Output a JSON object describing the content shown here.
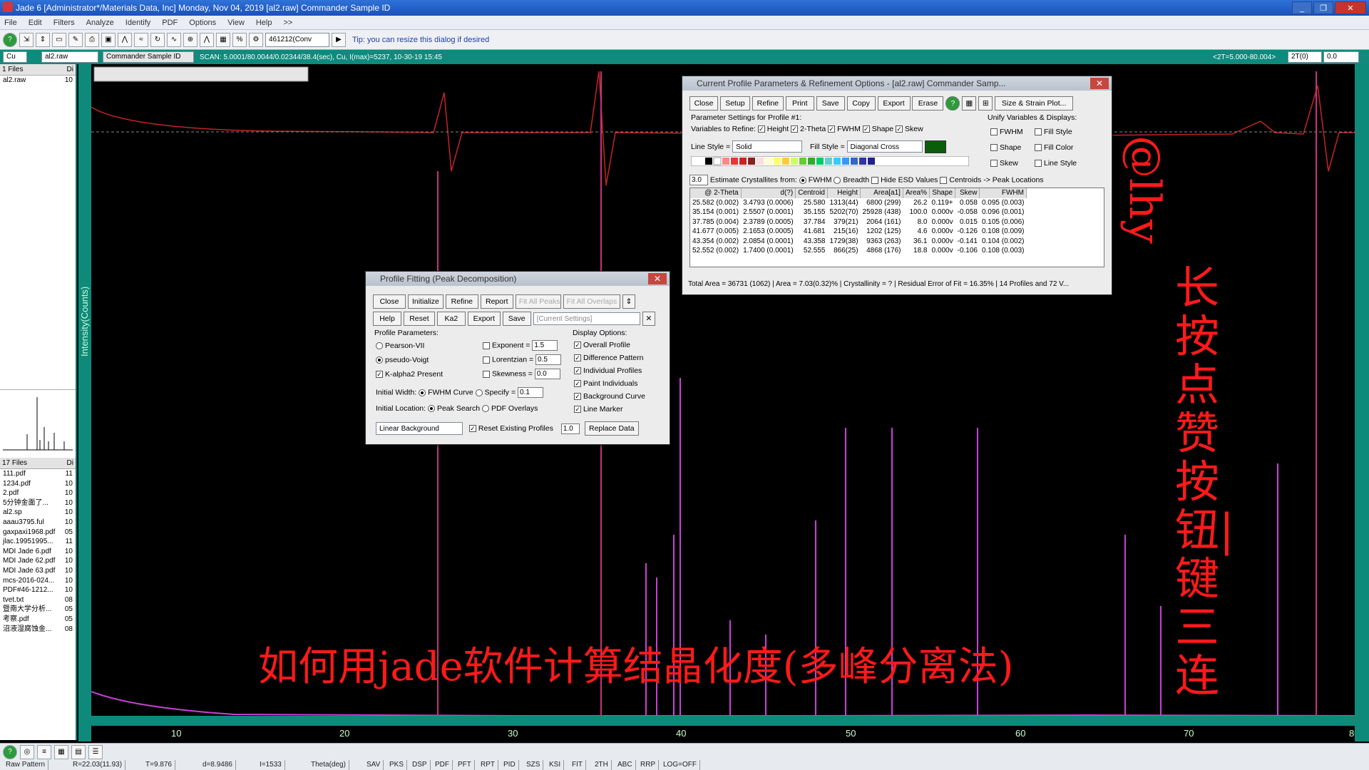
{
  "window": {
    "title": "Jade 6 [Administrator*/Materials Data, Inc] Monday, Nov 04, 2019 [al2.raw] Commander Sample ID",
    "buttons": [
      "_",
      "❐",
      "✕"
    ]
  },
  "menu": [
    "File",
    "Edit",
    "Filters",
    "Analyze",
    "Identify",
    "PDF",
    "Options",
    "View",
    "Help",
    ">>"
  ],
  "toolbar": {
    "combo_value": "461212(Conv",
    "tip": "Tip: you can resize this dialog if desired"
  },
  "toolbar2": {
    "element_combo": "Cu",
    "file_combo": "al2.raw",
    "sample_id": "Commander Sample ID",
    "scan_info": "SCAN: 5.0001/80.0044/0.02344/38.4(sec), Cu, I(max)=5237, 10-30-19 15:45",
    "right_readout": "<2T=5.000-80.004>",
    "right_value": "2T(0)",
    "right_value2": "0.0"
  },
  "left_pane": {
    "top_header": "1 Files",
    "top_header_count": "Di",
    "top_files": [
      {
        "name": "al2.raw",
        "n": "10"
      }
    ],
    "bottom_header": "17 Files",
    "bottom_header_count": "Di",
    "bottom_files": [
      {
        "name": "111.pdf",
        "n": "11"
      },
      {
        "name": "1234.pdf",
        "n": "10"
      },
      {
        "name": "2.pdf",
        "n": "10"
      },
      {
        "name": "5分钟金面了...",
        "n": "10"
      },
      {
        "name": "al2.sp",
        "n": "10"
      },
      {
        "name": "aaau3795.ful",
        "n": "10"
      },
      {
        "name": "gaxpaxi1968.pdf",
        "n": "05"
      },
      {
        "name": "jlac.19951995...",
        "n": "11"
      },
      {
        "name": "MDI Jade 6.pdf",
        "n": "10"
      },
      {
        "name": "MDI Jade 62.pdf",
        "n": "10"
      },
      {
        "name": "MDI Jade 63.pdf",
        "n": "10"
      },
      {
        "name": "mcs-2016-024...",
        "n": "10"
      },
      {
        "name": "PDF#46-1212...",
        "n": "10"
      },
      {
        "name": "tvet.txt",
        "n": "08"
      },
      {
        "name": "暨南大学分析...",
        "n": "05"
      },
      {
        "name": "考察.pdf",
        "n": "05"
      },
      {
        "name": "沼液湿腐蚀金...",
        "n": "08"
      }
    ]
  },
  "plot": {
    "y_label": "Intensity(Counts)",
    "x_ticks": [
      "10",
      "20",
      "30",
      "40",
      "50",
      "60",
      "70",
      "80"
    ]
  },
  "profile_dialog": {
    "title": "Profile Fitting (Peak Decomposition)",
    "row1": [
      "Close",
      "Initialize",
      "Refine",
      "Report",
      "Fit All Peaks",
      "Fit All Overlaps"
    ],
    "row2": [
      "Help",
      "Reset",
      "Ka2",
      "Export",
      "Save"
    ],
    "settings_combo": "[Current Settings]",
    "params_header": "Profile Parameters:",
    "pearson": "Pearson-VII",
    "pseudo": "pseudo-Voigt",
    "kalpha": "K-alpha2 Present",
    "exponent_label": "Exponent =",
    "exponent_value": "1.5",
    "lorentzian_label": "Lorentzian =",
    "lorentzian_value": "0.5",
    "skewness_label": "Skewness =",
    "skewness_value": "0.0",
    "display_header": "Display Options:",
    "display_opts": [
      "Overall Profile",
      "Difference Pattern",
      "Individual Profiles",
      "Paint Individuals",
      "Background Curve",
      "Line Marker"
    ],
    "initial_width_label": "Initial Width:",
    "fwhm_curve": "FWHM Curve",
    "specify": "Specify =",
    "specify_value": "0.1",
    "initial_location_label": "Initial Location:",
    "peak_search": "Peak Search",
    "pdf_overlays": "PDF Overlays",
    "background_combo": "Linear Background",
    "reset_existing": "Reset Existing Profiles",
    "replace_value": "1.0",
    "replace_button": "Replace Data"
  },
  "params_dialog": {
    "title": "Current Profile Parameters & Refinement Options - [al2.raw] Commander Samp...",
    "buttons": [
      "Close",
      "Setup",
      "Refine",
      "Print",
      "Save",
      "Copy",
      "Export",
      "Erase"
    ],
    "size_strain": "Size & Strain Plot...",
    "settings_header": "Parameter Settings for Profile #1:",
    "vars_label": "Variables to Refine:",
    "vars": [
      "Height",
      "2-Theta",
      "FWHM",
      "Shape",
      "Skew"
    ],
    "line_style_label": "Line Style =",
    "line_style": "Solid",
    "fill_style_label": "Fill Style =",
    "fill_style": "Diagonal Cross",
    "only_header": "Unify Variables & Displays:",
    "unify": [
      "FWHM",
      "Fill Style",
      "Shape",
      "Fill Color",
      "Skew",
      "Line Style"
    ],
    "estimate_value": "3.0",
    "estimate_label": "Estimate Crystallites from:",
    "estimate_opts": [
      "FWHM",
      "Breadth"
    ],
    "hide_esd": "Hide ESD Values",
    "centroids": "Centroids -> Peak Locations",
    "table_headers": [
      "@ 2-Theta",
      "d(?)",
      "Centroid",
      "Height",
      "Area[a1]",
      "Area%",
      "Shape",
      "Skew",
      "FWHM"
    ],
    "rows": [
      [
        "25.582 (0.002)",
        "3.4793 (0.0006)",
        "25.580",
        "1313(44)",
        "6800 (299)",
        "26.2",
        "0.119+",
        "0.058",
        "0.095 (0.003)"
      ],
      [
        "35.154 (0.001)",
        "2.5507 (0.0001)",
        "35.155",
        "5202(70)",
        "25928 (438)",
        "100.0",
        "0.000v",
        "-0.058",
        "0.096 (0.001)"
      ],
      [
        "37.785 (0.004)",
        "2.3789 (0.0005)",
        "37.784",
        "379(21)",
        "2064 (161)",
        "8.0",
        "0.000v",
        "0.015",
        "0.105 (0.006)"
      ],
      [
        "41.677 (0.005)",
        "2.1653 (0.0005)",
        "41.681",
        "215(16)",
        "1202 (125)",
        "4.6",
        "0.000v",
        "-0.126",
        "0.108 (0.009)"
      ],
      [
        "43.354 (0.002)",
        "2.0854 (0.0001)",
        "43.358",
        "1729(38)",
        "9363 (263)",
        "36.1",
        "0.000v",
        "-0.141",
        "0.104 (0.002)"
      ],
      [
        "52.552 (0.002)",
        "1.7400 (0.0001)",
        "52.555",
        "866(25)",
        "4868 (176)",
        "18.8",
        "0.000v",
        "-0.106",
        "0.108 (0.003)"
      ]
    ],
    "status": [
      "Total Area = 36731 (1062)",
      "Area = 7.03(0.32)%",
      "Crystallinity = ?",
      "Residual Error of Fit = 16.35%",
      "14 Profiles and 72 V..."
    ]
  },
  "watermark": {
    "handle": "@lhy",
    "vertical": "长按点赞按钮|键三连",
    "caption": "如何用jade软件计算结晶化度(多峰分离法)"
  },
  "statusbar": [
    "Raw Pattern",
    "R=22.03(11.93)",
    "T=9.876",
    "d=8.9486",
    "I=1533",
    "Theta(deg)",
    "SAV",
    "PKS",
    "DSP",
    "PDF",
    "PFT",
    "RPT",
    "PID",
    "SZS",
    "KSI",
    "FIT",
    "2TH",
    "ABC",
    "RRP",
    "LOG=OFF"
  ],
  "colors": {
    "teal": "#0e8a7b",
    "watermark": "#ff1a1a",
    "pattern": "#cc3fd9",
    "top_curve": "#c42525"
  }
}
